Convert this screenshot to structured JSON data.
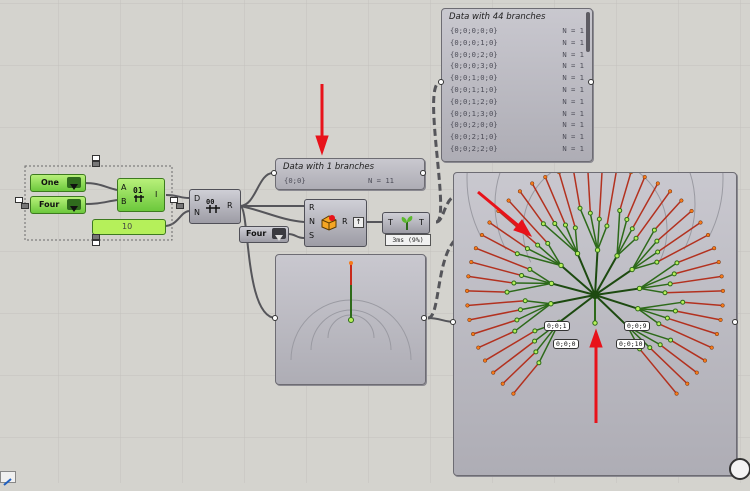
{
  "canvas": {
    "background": "#d4d3ce",
    "wire_color": "#55555a",
    "accent_green": "#7ad13c",
    "arrow_color": "#e8121a"
  },
  "top_panel": {
    "title": "Data with 44 branches",
    "rows": [
      {
        "path": "{0;0;0;0;0}",
        "n": "N = 1"
      },
      {
        "path": "{0;0;0;1;0}",
        "n": "N = 1"
      },
      {
        "path": "{0;0;0;2;0}",
        "n": "N = 1"
      },
      {
        "path": "{0;0;0;3;0}",
        "n": "N = 1"
      },
      {
        "path": "{0;0;1;0;0}",
        "n": "N = 1"
      },
      {
        "path": "{0;0;1;1;0}",
        "n": "N = 1"
      },
      {
        "path": "{0;0;1;2;0}",
        "n": "N = 1"
      },
      {
        "path": "{0;0;1;3;0}",
        "n": "N = 1"
      },
      {
        "path": "{0;0;2;0;0}",
        "n": "N = 1"
      },
      {
        "path": "{0;0;2;1;0}",
        "n": "N = 1"
      },
      {
        "path": "{0;0;2;2;0}",
        "n": "N = 1"
      }
    ]
  },
  "mid_panel": {
    "title": "Data with 1 branches",
    "path": "{0;0}",
    "n": "N = 11"
  },
  "inputs": {
    "drop_a": "One",
    "drop_b": "Four",
    "slider_value": "10",
    "drop_c": "Four"
  },
  "components": {
    "ab_inputs": [
      "A",
      "B"
    ],
    "ab_out": "I",
    "dr_inputs": [
      "D",
      "N"
    ],
    "dr_out": "R",
    "rns_inputs": [
      "R",
      "N",
      "S"
    ],
    "rns_out": "R",
    "tt_in": "T",
    "tt_out": "T",
    "timer": "3ms (9%)"
  },
  "tree_labels": [
    "0;0;1",
    "0;0;0",
    "0;0;9",
    "0;0;10"
  ]
}
